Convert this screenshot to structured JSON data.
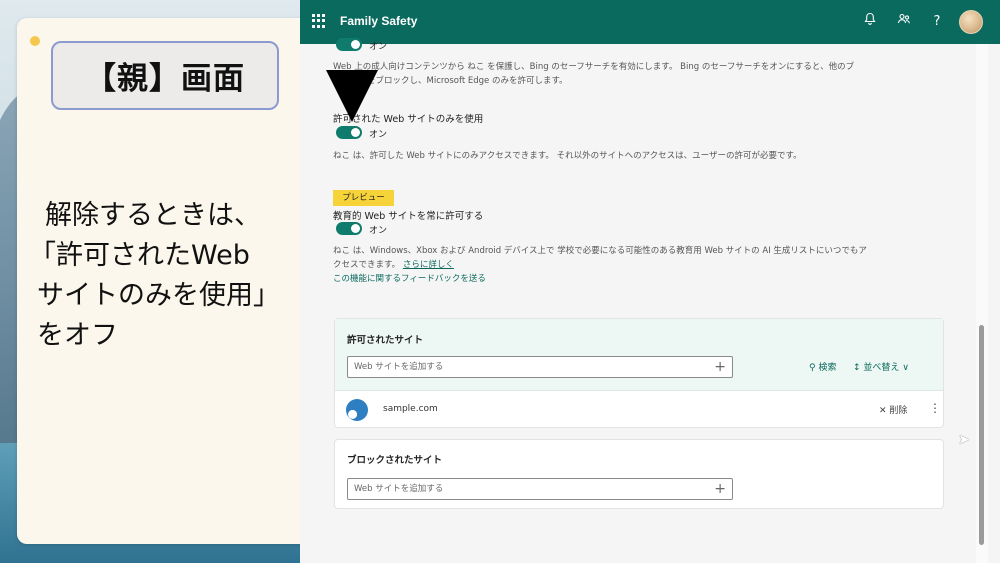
{
  "note": {
    "tag": "【親】画面",
    "message_lines": [
      "解除するときは、",
      "「許可されたWeb",
      "サイトのみを使用」",
      "をオフ"
    ]
  },
  "app": {
    "title": "Family Safety",
    "topbar_icons": [
      "bell-icon",
      "people-icon",
      "help-icon"
    ],
    "help_glyph": "?"
  },
  "settings": {
    "toggle1_state": "オン",
    "desc1_line1": "Web 上の成人向けコンテンツから ねこ を保護し、Bing のセーフサーチを有効にします。 Bing のセーフサーチをオンにすると、他のブ",
    "desc1_line2": "ラウザーをブロックし、Microsoft Edge のみを許可します。",
    "allowed_only_label": "許可された Web サイトのみを使用",
    "toggle2_state": "オン",
    "desc2": "ねこ は、許可した Web サイトにのみアクセスできます。 それ以外のサイトへのアクセスは、ユーザーの許可が必要です。",
    "preview_badge": "プレビュー",
    "edu_label": "教育的 Web サイトを常に許可する",
    "toggle3_state": "オン",
    "desc3_line1": "ねこ は、Windows、Xbox および Android デバイス上で 学校で必要になる可能性のある教育用 Web サイトの AI 生成リストにいつでもア",
    "desc3_line2_prefix": "クセスできます。 ",
    "learn_more": "さらに詳しく",
    "feedback": "この機能に関するフィードバックを送る"
  },
  "allowed_sites": {
    "title": "許可されたサイト",
    "input_placeholder": "Web サイトを追加する",
    "search_label": "検索",
    "sort_label": "並べ替え",
    "items": [
      {
        "name": "sample.com",
        "remove_label": "削除"
      }
    ]
  },
  "blocked_sites": {
    "title": "ブロックされたサイト",
    "input_placeholder": "Web サイトを追加する"
  },
  "colors": {
    "topbar": "#0b6a5e",
    "toggle_on": "#0f7b6c",
    "preview_badge": "#f7d33a",
    "tag_border": "#8c9bcf"
  }
}
